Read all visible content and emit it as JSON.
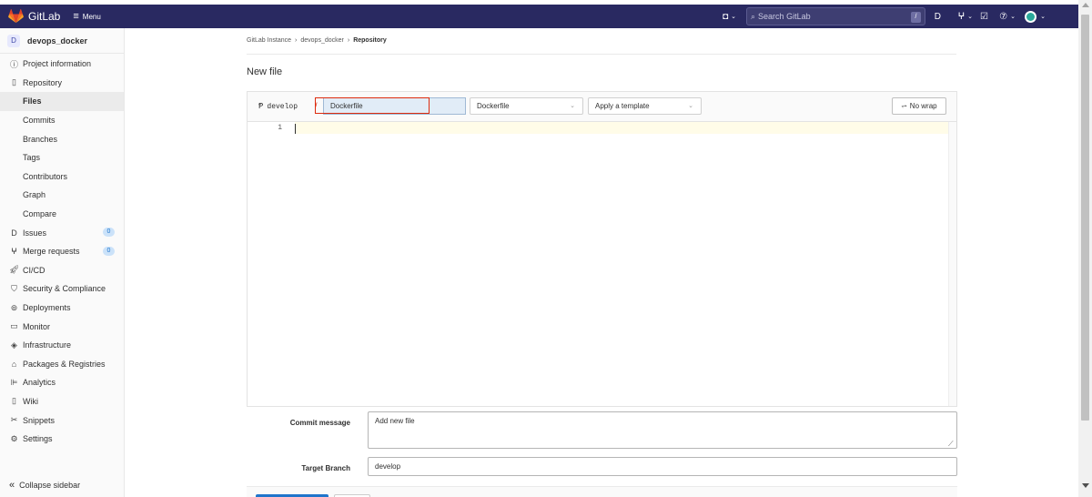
{
  "topbar": {
    "brand": "GitLab",
    "menu_label": "Menu",
    "search_placeholder": "Search GitLab",
    "search_shortcut": "/",
    "icons": [
      "plus-square-icon",
      "issues-icon",
      "merge-request-icon",
      "todo-icon",
      "help-icon",
      "user-avatar"
    ]
  },
  "sidebar": {
    "project_initial": "D",
    "project_name": "devops_docker",
    "items": [
      {
        "label": "Project information",
        "icon": "info-icon"
      },
      {
        "label": "Repository",
        "icon": "repo-icon"
      },
      {
        "label": "Files"
      },
      {
        "label": "Commits"
      },
      {
        "label": "Branches"
      },
      {
        "label": "Tags"
      },
      {
        "label": "Contributors"
      },
      {
        "label": "Graph"
      },
      {
        "label": "Compare"
      },
      {
        "label": "Issues",
        "icon": "issues-icon",
        "badge": "0"
      },
      {
        "label": "Merge requests",
        "icon": "merge-request-icon",
        "badge": "0"
      },
      {
        "label": "CI/CD",
        "icon": "rocket-icon"
      },
      {
        "label": "Security & Compliance",
        "icon": "shield-icon"
      },
      {
        "label": "Deployments",
        "icon": "deployments-icon"
      },
      {
        "label": "Monitor",
        "icon": "monitor-icon"
      },
      {
        "label": "Infrastructure",
        "icon": "cloud-icon"
      },
      {
        "label": "Packages & Registries",
        "icon": "package-icon"
      },
      {
        "label": "Analytics",
        "icon": "chart-icon"
      },
      {
        "label": "Wiki",
        "icon": "book-icon"
      },
      {
        "label": "Snippets",
        "icon": "scissors-icon"
      },
      {
        "label": "Settings",
        "icon": "gear-icon"
      }
    ],
    "collapse_label": "Collapse sidebar"
  },
  "breadcrumb": {
    "items": [
      "GitLab Instance",
      "devops_docker",
      "Repository"
    ]
  },
  "page": {
    "title": "New file"
  },
  "editor": {
    "branch": "develop",
    "path_separator": "/",
    "filename_value": "Dockerfile",
    "file_type": "Dockerfile",
    "template_placeholder": "Apply a template",
    "wrap_label": "No wrap",
    "line_number": "1"
  },
  "commit": {
    "message_label": "Commit message",
    "message_value": "Add new file",
    "target_label": "Target Branch",
    "target_value": "develop"
  },
  "colors": {
    "topbar": "#292961",
    "highlight_box": "#dd2b0e",
    "primary": "#1f75cb"
  }
}
